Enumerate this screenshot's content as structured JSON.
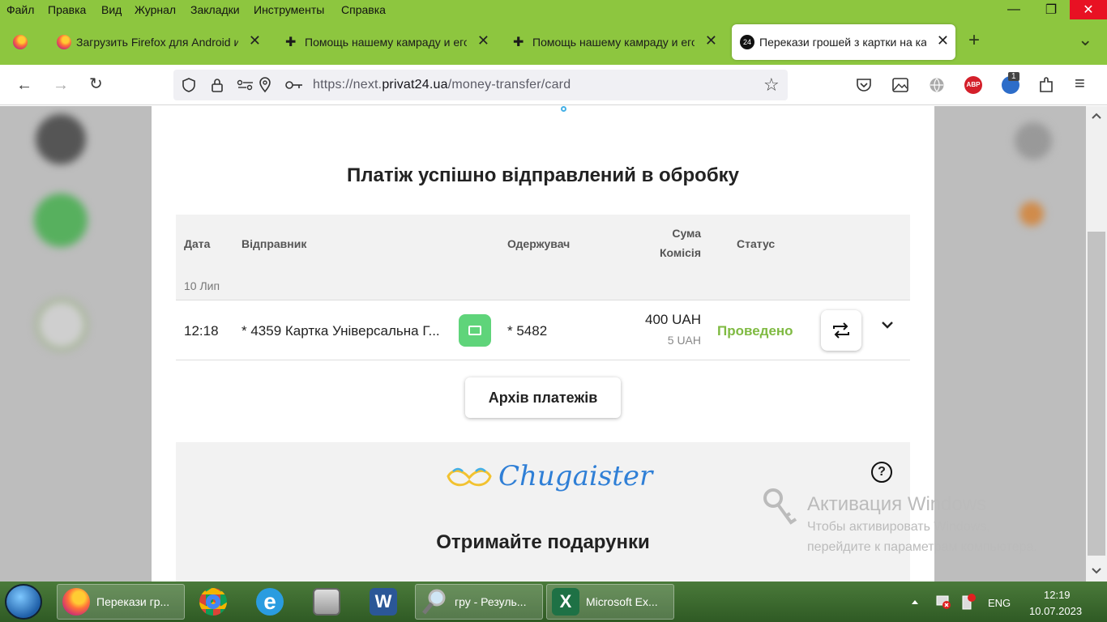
{
  "menu": [
    "Файл",
    "Правка",
    "Вид",
    "Журнал",
    "Закладки",
    "Инструменты",
    "Справка"
  ],
  "window_controls": {
    "minimize": "—",
    "maximize": "❐",
    "close": "✕"
  },
  "tabs": [
    {
      "label": "Загрузить Firefox для Android и iOS",
      "active": false
    },
    {
      "label": "Помощь нашему камраду и его семье",
      "active": false
    },
    {
      "label": "Помощь нашему камраду и его семье",
      "active": false
    },
    {
      "label": "Перекази грошей з картки на картку",
      "active": true
    }
  ],
  "tab_icons": {
    "active_favicon": "24",
    "close": "✕",
    "new_tab": "+",
    "list_all": "⌄",
    "cross": "✚"
  },
  "address": {
    "prefix": "https://next.",
    "domain": "privat24.ua",
    "path": "/money-transfer/card"
  },
  "toolbar_icons": {
    "back": "←",
    "forward": "→",
    "reload": "↻",
    "star": "☆",
    "menu": "≡",
    "badge": "1",
    "abp": "ABP"
  },
  "page": {
    "title": "Платіж успішно відправлений в обробку",
    "headers": {
      "date": "Дата",
      "sender": "Відправник",
      "recipient": "Одержувач",
      "sum": "Сума",
      "fee": "Комісія",
      "status": "Статус"
    },
    "group_date": "10 Лип",
    "row": {
      "time": "12:18",
      "sender": "* 4359 Картка Універсальна Г...",
      "recipient": "* 5482",
      "amount": "400 UAH",
      "fee": "5 UAH",
      "status": "Проведено"
    },
    "archive_button": "Архів платежів",
    "promo": {
      "brand": "Chugaister",
      "heading": "Отримайте подарунки",
      "help": "?"
    }
  },
  "watermark": {
    "title": "Активация Windows",
    "line1": "Чтобы активировать Windows,",
    "line2": "перейдите к параметрам компьютера."
  },
  "taskbar": {
    "items": [
      "Перекази гр...",
      "",
      "",
      "",
      "",
      "гру - Резуль...",
      "Microsoft Ex..."
    ],
    "lang": "ENG",
    "time": "12:19",
    "date": "10.07.2023"
  },
  "colors": {
    "accent": "#8dc63f",
    "status": "#7fba42",
    "card_icon": "#5fd47a",
    "brand": "#2f7fd6"
  }
}
